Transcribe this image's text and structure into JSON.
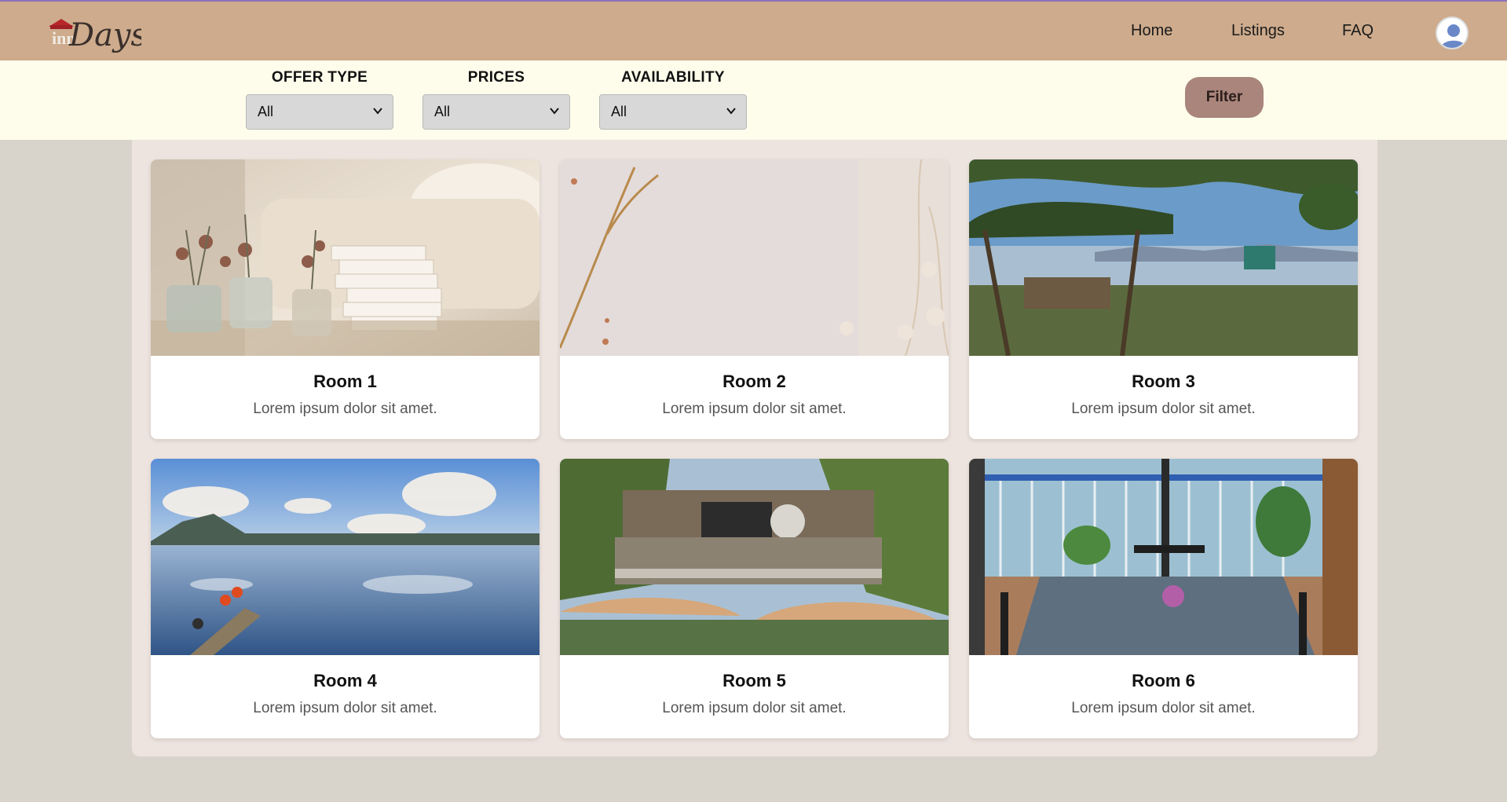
{
  "brand": {
    "logo_text": "Days",
    "logo_prefix": "inn"
  },
  "nav": {
    "links": [
      "Home",
      "Listings",
      "FAQ"
    ]
  },
  "filters": {
    "offer_type": {
      "label": "OFFER TYPE",
      "value": "All"
    },
    "prices": {
      "label": "PRICES",
      "value": "All"
    },
    "availability": {
      "label": "AVAILABILITY",
      "value": "All"
    },
    "button_label": "Filter"
  },
  "rooms": [
    {
      "title": "Room 1",
      "description": "Lorem ipsum dolor sit amet.",
      "image": "dried-flowers-books-icon"
    },
    {
      "title": "Room 2",
      "description": "Lorem ipsum dolor sit amet.",
      "image": "pale-dried-plants-icon"
    },
    {
      "title": "Room 3",
      "description": "Lorem ipsum dolor sit amet.",
      "image": "lakeside-swing-icon"
    },
    {
      "title": "Room 4",
      "description": "Lorem ipsum dolor sit amet.",
      "image": "lake-raft-icon"
    },
    {
      "title": "Room 5",
      "description": "Lorem ipsum dolor sit amet.",
      "image": "house-umbrellas-icon"
    },
    {
      "title": "Room 6",
      "description": "Lorem ipsum dolor sit amet.",
      "image": "balcony-dining-icon"
    }
  ],
  "colors": {
    "navbar": "#cdab8c",
    "filter_bar": "#fefdec",
    "filter_button": "#a9857c",
    "container": "#eee4df",
    "page_bg": "#d8d4cc"
  }
}
